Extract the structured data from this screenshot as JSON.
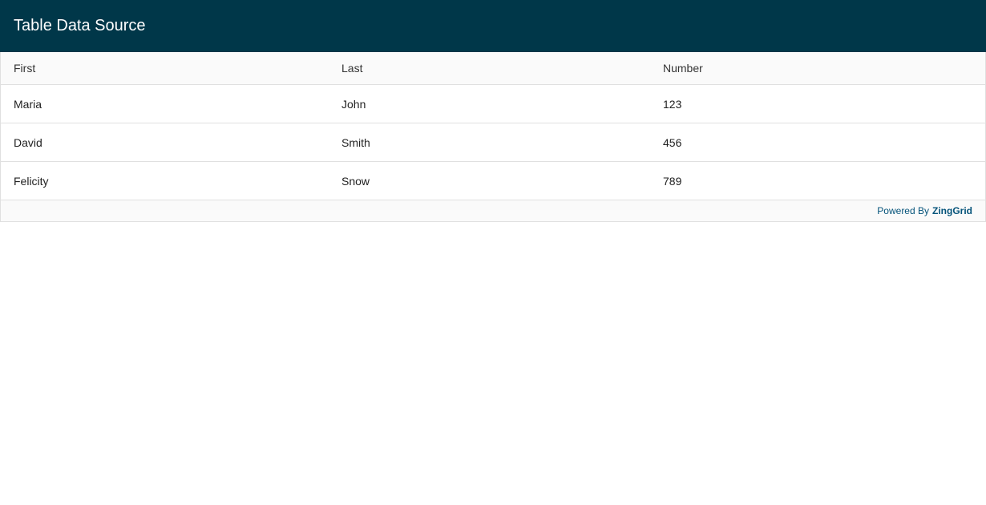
{
  "caption": "Table Data Source",
  "columns": [
    "First",
    "Last",
    "Number"
  ],
  "rows": [
    [
      "Maria",
      "John",
      "123"
    ],
    [
      "David",
      "Smith",
      "456"
    ],
    [
      "Felicity",
      "Snow",
      "789"
    ]
  ],
  "footer": {
    "prefix": "Powered By",
    "brand": "ZingGrid"
  },
  "colors": {
    "caption_background": "#003749",
    "footer_text": "#04537a"
  }
}
